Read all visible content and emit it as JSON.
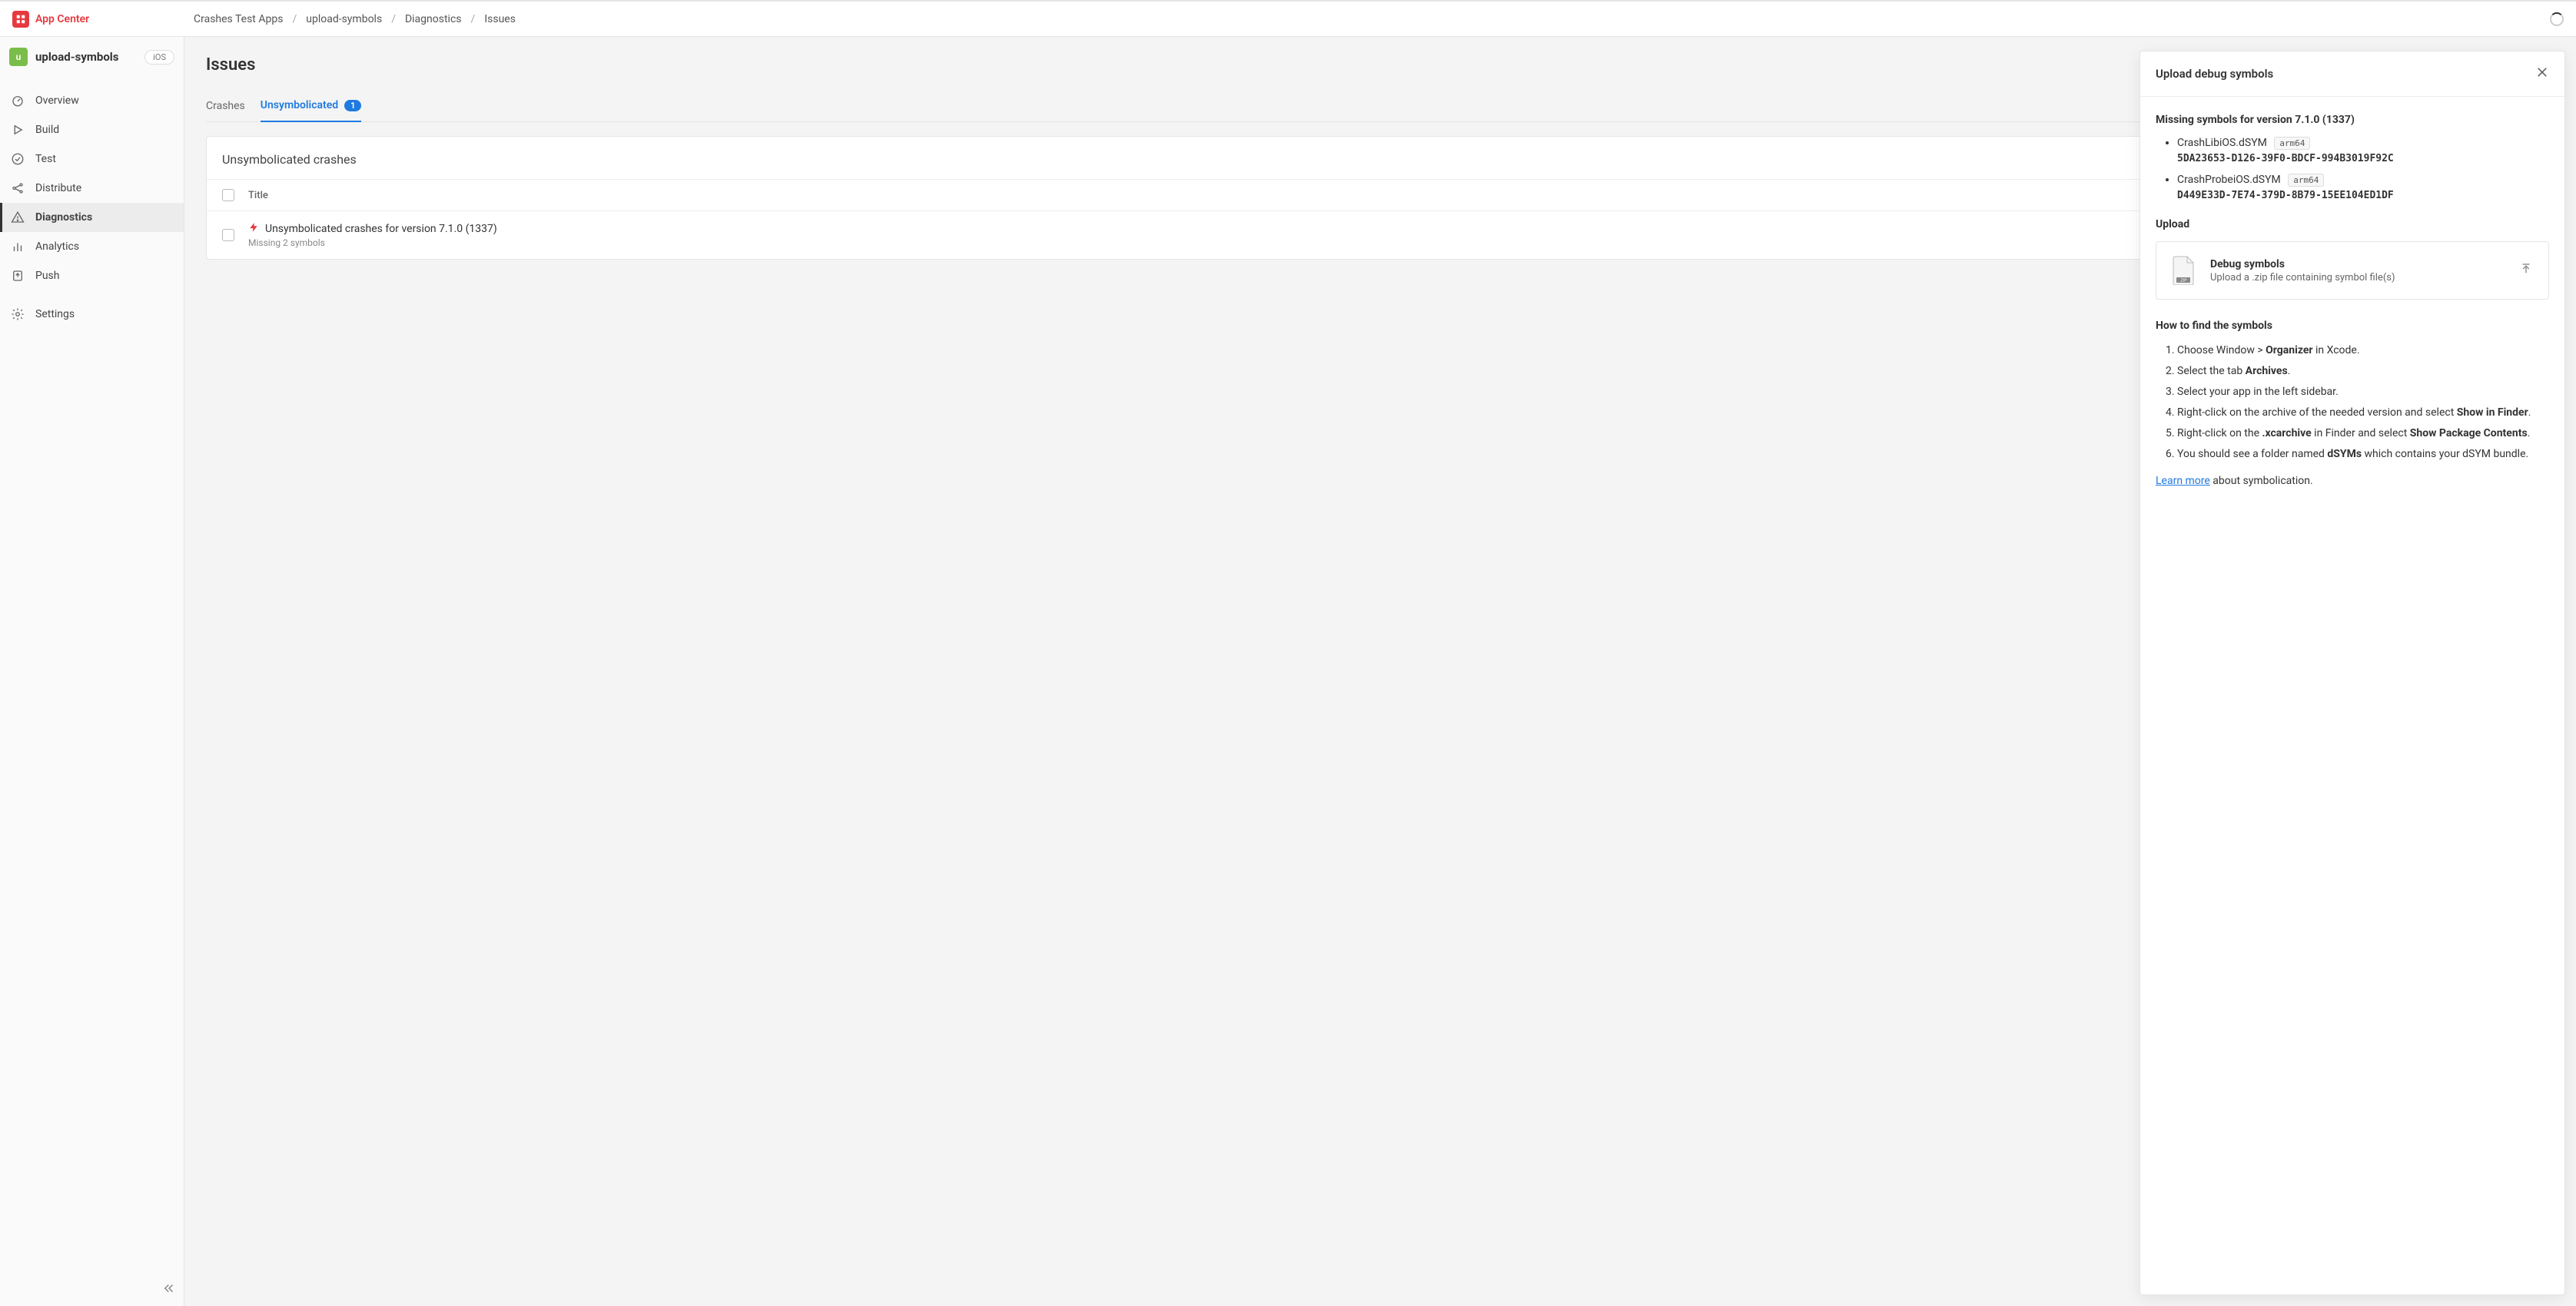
{
  "brand": "App Center",
  "breadcrumbs": [
    "Crashes Test Apps",
    "upload-symbols",
    "Diagnostics",
    "Issues"
  ],
  "app": {
    "avatar_letter": "u",
    "name": "upload-symbols",
    "platform": "iOS"
  },
  "nav": {
    "overview": "Overview",
    "build": "Build",
    "test": "Test",
    "distribute": "Distribute",
    "diagnostics": "Diagnostics",
    "analytics": "Analytics",
    "push": "Push",
    "settings": "Settings"
  },
  "page": {
    "title": "Issues",
    "tabs": {
      "crashes": "Crashes",
      "unsymbolicated": "Unsymbolicated",
      "unsymbolicated_count": "1"
    },
    "card_title": "Unsymbolicated crashes",
    "column_title": "Title",
    "row": {
      "title": "Unsymbolicated crashes for version 7.1.0 (1337)",
      "subtitle": "Missing 2 symbols"
    }
  },
  "panel": {
    "title": "Upload debug symbols",
    "missing_heading": "Missing symbols for version 7.1.0 (1337)",
    "symbols": [
      {
        "name": "CrashLibiOS.dSYM",
        "arch": "arm64",
        "uuid": "5DA23653-D126-39F0-BDCF-994B3019F92C"
      },
      {
        "name": "CrashProbeiOS.dSYM",
        "arch": "arm64",
        "uuid": "D449E33D-7E74-379D-8B79-15EE104ED1DF"
      }
    ],
    "upload_heading": "Upload",
    "dropzone": {
      "title": "Debug symbols",
      "subtitle": "Upload a .zip file containing symbol file(s)",
      "zip_label": ".ZIP"
    },
    "howto_heading": "How to find the symbols",
    "howto": {
      "step1_a": "Choose Window > ",
      "step1_b": "Organizer",
      "step1_c": " in Xcode.",
      "step2_a": "Select the tab ",
      "step2_b": "Archives",
      "step2_c": ".",
      "step3": "Select your app in the left sidebar.",
      "step4_a": "Right-click on the archive of the needed version and select ",
      "step4_b": "Show in Finder",
      "step4_c": ".",
      "step5_a": "Right-click on the ",
      "step5_b": ".xcarchive",
      "step5_c": " in Finder and select ",
      "step5_d": "Show Package Contents",
      "step5_e": ".",
      "step6_a": "You should see a folder named ",
      "step6_b": "dSYMs",
      "step6_c": " which contains your dSYM bundle."
    },
    "learn_more": "Learn more",
    "learn_more_suffix": " about symbolication."
  }
}
